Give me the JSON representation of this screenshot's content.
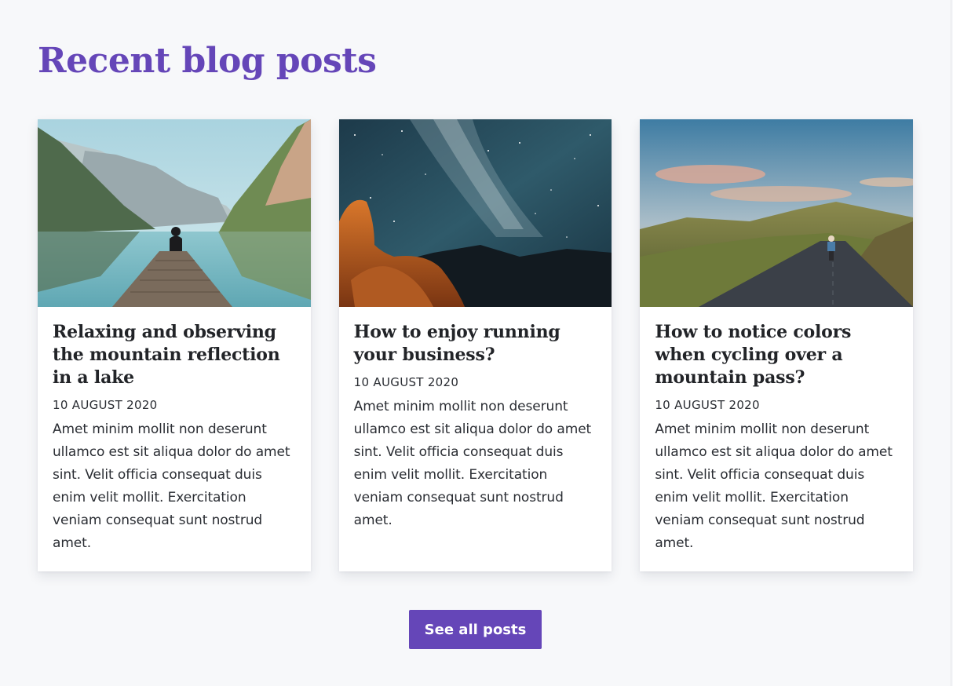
{
  "section": {
    "title": "Recent blog posts"
  },
  "posts": [
    {
      "image_alt": "person-sitting-on-pier-mountain-lake",
      "title": "Relaxing and observing the mountain reflection in a lake",
      "date": "10 AUGUST 2020",
      "excerpt": "Amet minim mollit non deserunt ullamco est sit aliqua dolor do amet sint. Velit officia consequat duis enim velit mollit. Exercitation veniam consequat sunt nostrud amet."
    },
    {
      "image_alt": "milky-way-night-sky-rocks",
      "title": "How to enjoy running your business?",
      "date": "10 AUGUST 2020",
      "excerpt": "Amet minim mollit non deserunt ullamco est sit aliqua dolor do amet sint. Velit officia consequat duis enim velit mollit. Exercitation veniam consequat sunt nostrud amet."
    },
    {
      "image_alt": "cyclist-on-mountain-road-sunset",
      "title": "How to notice colors when cycling over a mountain pass?",
      "date": "10 AUGUST 2020",
      "excerpt": "Amet minim mollit non deserunt ullamco est sit aliqua dolor do amet sint. Velit officia consequat duis enim velit mollit. Exercitation veniam consequat sunt nostrud amet."
    }
  ],
  "cta": {
    "label": "See all posts"
  },
  "colors": {
    "accent": "#6546b8",
    "background": "#f7f8fa",
    "card": "#ffffff",
    "text": "#222428"
  }
}
